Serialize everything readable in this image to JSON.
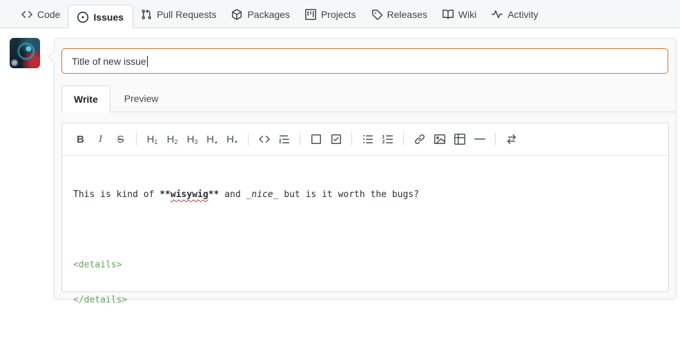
{
  "nav": {
    "items": [
      {
        "label": "Code",
        "icon": "code-icon",
        "active": false
      },
      {
        "label": "Issues",
        "icon": "issue-opened-icon",
        "active": true
      },
      {
        "label": "Pull Requests",
        "icon": "git-pull-request-icon",
        "active": false
      },
      {
        "label": "Packages",
        "icon": "package-icon",
        "active": false
      },
      {
        "label": "Projects",
        "icon": "project-icon",
        "active": false
      },
      {
        "label": "Releases",
        "icon": "tag-icon",
        "active": false
      },
      {
        "label": "Wiki",
        "icon": "book-icon",
        "active": false
      },
      {
        "label": "Activity",
        "icon": "pulse-icon",
        "active": false
      }
    ]
  },
  "issue_form": {
    "title": {
      "value": "Title of new issue"
    },
    "tabs": {
      "write": "Write",
      "preview": "Preview",
      "active_tab": "Write"
    },
    "toolbar": {
      "glyphs": {
        "bold": "B",
        "italic": "I",
        "strike": "S",
        "h": "H",
        "h1_sub": "1",
        "h2_sub": "2",
        "h3_sub": "3",
        "h_up_sub": "▲",
        "h_down_sub": "▼",
        "code": "<>"
      },
      "icons": [
        "bold-icon",
        "italic-icon",
        "strikethrough-icon",
        "heading-1-icon",
        "heading-2-icon",
        "heading-3-icon",
        "heading-increase-icon",
        "heading-decrease-icon",
        "code-icon",
        "quote-icon",
        "square-icon",
        "checkbox-checked-icon",
        "list-unordered-icon",
        "list-ordered-icon",
        "link-icon",
        "image-icon",
        "table-icon",
        "horizontal-rule-icon",
        "switch-editor-icon"
      ]
    },
    "editor": {
      "line1": {
        "prefix": "This is kind of ",
        "bold_open": "**",
        "bold_word": "wisywig",
        "bold_close": "**",
        "mid": " and ",
        "italic": "_nice_",
        "suffix": " but is it worth the bugs?"
      },
      "line2": "<details>",
      "line3": "</details>"
    }
  },
  "colors": {
    "focus_border_orange": "#cf7430",
    "html_tag_green": "#63a35c",
    "spellcheck_red": "#c5352c",
    "nav_bg": "#f6f7f9"
  }
}
